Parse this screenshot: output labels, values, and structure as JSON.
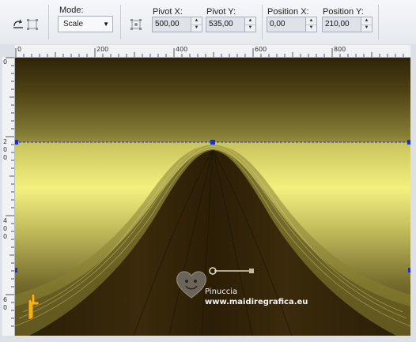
{
  "toolbar": {
    "mode_label": "Mode:",
    "mode_value": "Scale",
    "pivot_x_label": "Pivot X:",
    "pivot_x_value": "500,00",
    "pivot_y_label": "Pivot Y:",
    "pivot_y_value": "535,00",
    "position_x_label": "Position X:",
    "position_x_value": "0,00",
    "position_y_label": "Position Y:",
    "position_y_value": "210,00"
  },
  "ruler": {
    "top_labels": [
      "0",
      "200",
      "400",
      "600",
      "800"
    ],
    "left_labels": [
      [
        "0"
      ],
      [
        "2",
        "0",
        "0"
      ],
      [
        "4",
        "0",
        "0"
      ],
      [
        "6",
        "0"
      ]
    ]
  },
  "watermark": {
    "name": "Pinuccia",
    "url": "www.maidiregrafica.eu"
  },
  "colors": {
    "gold_light": "#f2ee80",
    "gold_dark": "#2c2307",
    "guide": "#1a2fd0"
  }
}
